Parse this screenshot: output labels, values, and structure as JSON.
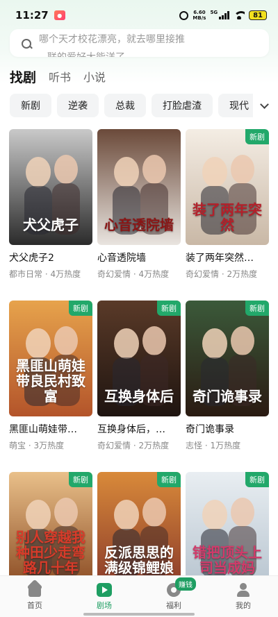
{
  "status_bar": {
    "time": "11:27",
    "app_icon": "app-notification-icon",
    "net_speed_value": "6.60",
    "net_speed_unit": "MB/s",
    "signal_label": "5G",
    "battery": "81"
  },
  "search": {
    "line1": "哪个天才校花漂亮，就去哪里接推",
    "line2": "联的爱好大能洋了"
  },
  "main_tabs": [
    {
      "label": "找剧",
      "active": true
    },
    {
      "label": "听书",
      "active": false
    },
    {
      "label": "小说",
      "active": false
    }
  ],
  "chips": [
    "新剧",
    "逆袭",
    "总裁",
    "打脸虐渣",
    "现代"
  ],
  "badge_text": "新剧",
  "cards": [
    {
      "title": "犬父虎子2",
      "meta": "都市日常 · 4万热度",
      "poster_text": "犬父虎子",
      "new": false,
      "colors": [
        "#c9c9c9",
        "#2b2b2b"
      ],
      "title_color": "#ffffff"
    },
    {
      "title": "心音透院墙",
      "meta": "奇幻爱情 · 4万热度",
      "poster_text": "心音透院墙",
      "new": false,
      "colors": [
        "#6b4a3a",
        "#e9e4df"
      ],
      "title_color": "#8a1515"
    },
    {
      "title": "装了两年突然…",
      "meta": "奇幻爱情 · 2万热度",
      "poster_text": "装了两年突然",
      "new": true,
      "colors": [
        "#f4ede4",
        "#c9b8a6"
      ],
      "title_color": "#b4202a"
    },
    {
      "title": "黑匪山萌娃带…",
      "meta": "萌宝 · 3万热度",
      "poster_text": "黑匪山萌娃带良民村致富",
      "new": true,
      "colors": [
        "#e7a34c",
        "#b3542a"
      ],
      "title_color": "#ffffff"
    },
    {
      "title": "互换身体后，…",
      "meta": "奇幻爱情 · 2万热度",
      "poster_text": "互换身体后",
      "new": true,
      "colors": [
        "#5a3a28",
        "#1e1410"
      ],
      "title_color": "#ffffff"
    },
    {
      "title": "奇门诡事录",
      "meta": "志怪 · 1万热度",
      "poster_text": "奇门诡事录",
      "new": true,
      "colors": [
        "#3b5a3a",
        "#2a1a12"
      ],
      "title_color": "#ffffff"
    },
    {
      "title": "",
      "meta": "",
      "poster_text": "别人穿越我种田少走弯路几十年",
      "new": true,
      "colors": [
        "#e9c08a",
        "#8a4a22"
      ],
      "title_color": "#d83b2a"
    },
    {
      "title": "",
      "meta": "",
      "poster_text": "反派思思的满级锦鲤娘",
      "new": true,
      "colors": [
        "#d98a3a",
        "#8a3a2a"
      ],
      "title_color": "#ffffff"
    },
    {
      "title": "",
      "meta": "",
      "poster_text": "错把顶头上司当成妈",
      "new": true,
      "colors": [
        "#e9eef2",
        "#b7c4cf"
      ],
      "title_color": "#d23a6a"
    }
  ],
  "bottom_nav": [
    {
      "label": "首页",
      "icon": "home-icon",
      "active": false
    },
    {
      "label": "剧场",
      "icon": "theater-icon",
      "active": true
    },
    {
      "label": "福利",
      "icon": "gift-icon",
      "active": false,
      "badge": "赚钱"
    },
    {
      "label": "我的",
      "icon": "user-icon",
      "active": false
    }
  ]
}
